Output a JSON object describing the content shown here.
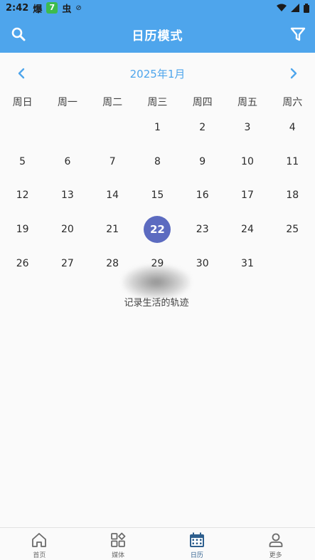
{
  "status_bar": {
    "time": "2:42",
    "app_glyph_1": "爆",
    "badge": "7",
    "app_glyph_2": "虫",
    "sync": "⊘"
  },
  "app_bar": {
    "title": "日历模式"
  },
  "calendar": {
    "month_label": "2025年1月",
    "weekdays": [
      "周日",
      "周一",
      "周二",
      "周三",
      "周四",
      "周五",
      "周六"
    ],
    "leading_blanks": 3,
    "days": [
      1,
      2,
      3,
      4,
      5,
      6,
      7,
      8,
      9,
      10,
      11,
      12,
      13,
      14,
      15,
      16,
      17,
      18,
      19,
      20,
      21,
      22,
      23,
      24,
      25,
      26,
      27,
      28,
      29,
      30,
      31
    ],
    "selected_day": 22
  },
  "overlay": {
    "caption": "记录生活的轨迹"
  },
  "bottom_nav": {
    "items": [
      {
        "label": "首页",
        "icon": "home-icon"
      },
      {
        "label": "媒体",
        "icon": "grid-icon"
      },
      {
        "label": "日历",
        "icon": "calendar-icon"
      },
      {
        "label": "更多",
        "icon": "person-icon"
      }
    ],
    "active_index": 2
  },
  "colors": {
    "primary": "#4ea5ec",
    "selected_day_bg": "#5c6bc0",
    "active_nav": "#2e5f8e",
    "inactive_nav": "#6b6b6b"
  }
}
